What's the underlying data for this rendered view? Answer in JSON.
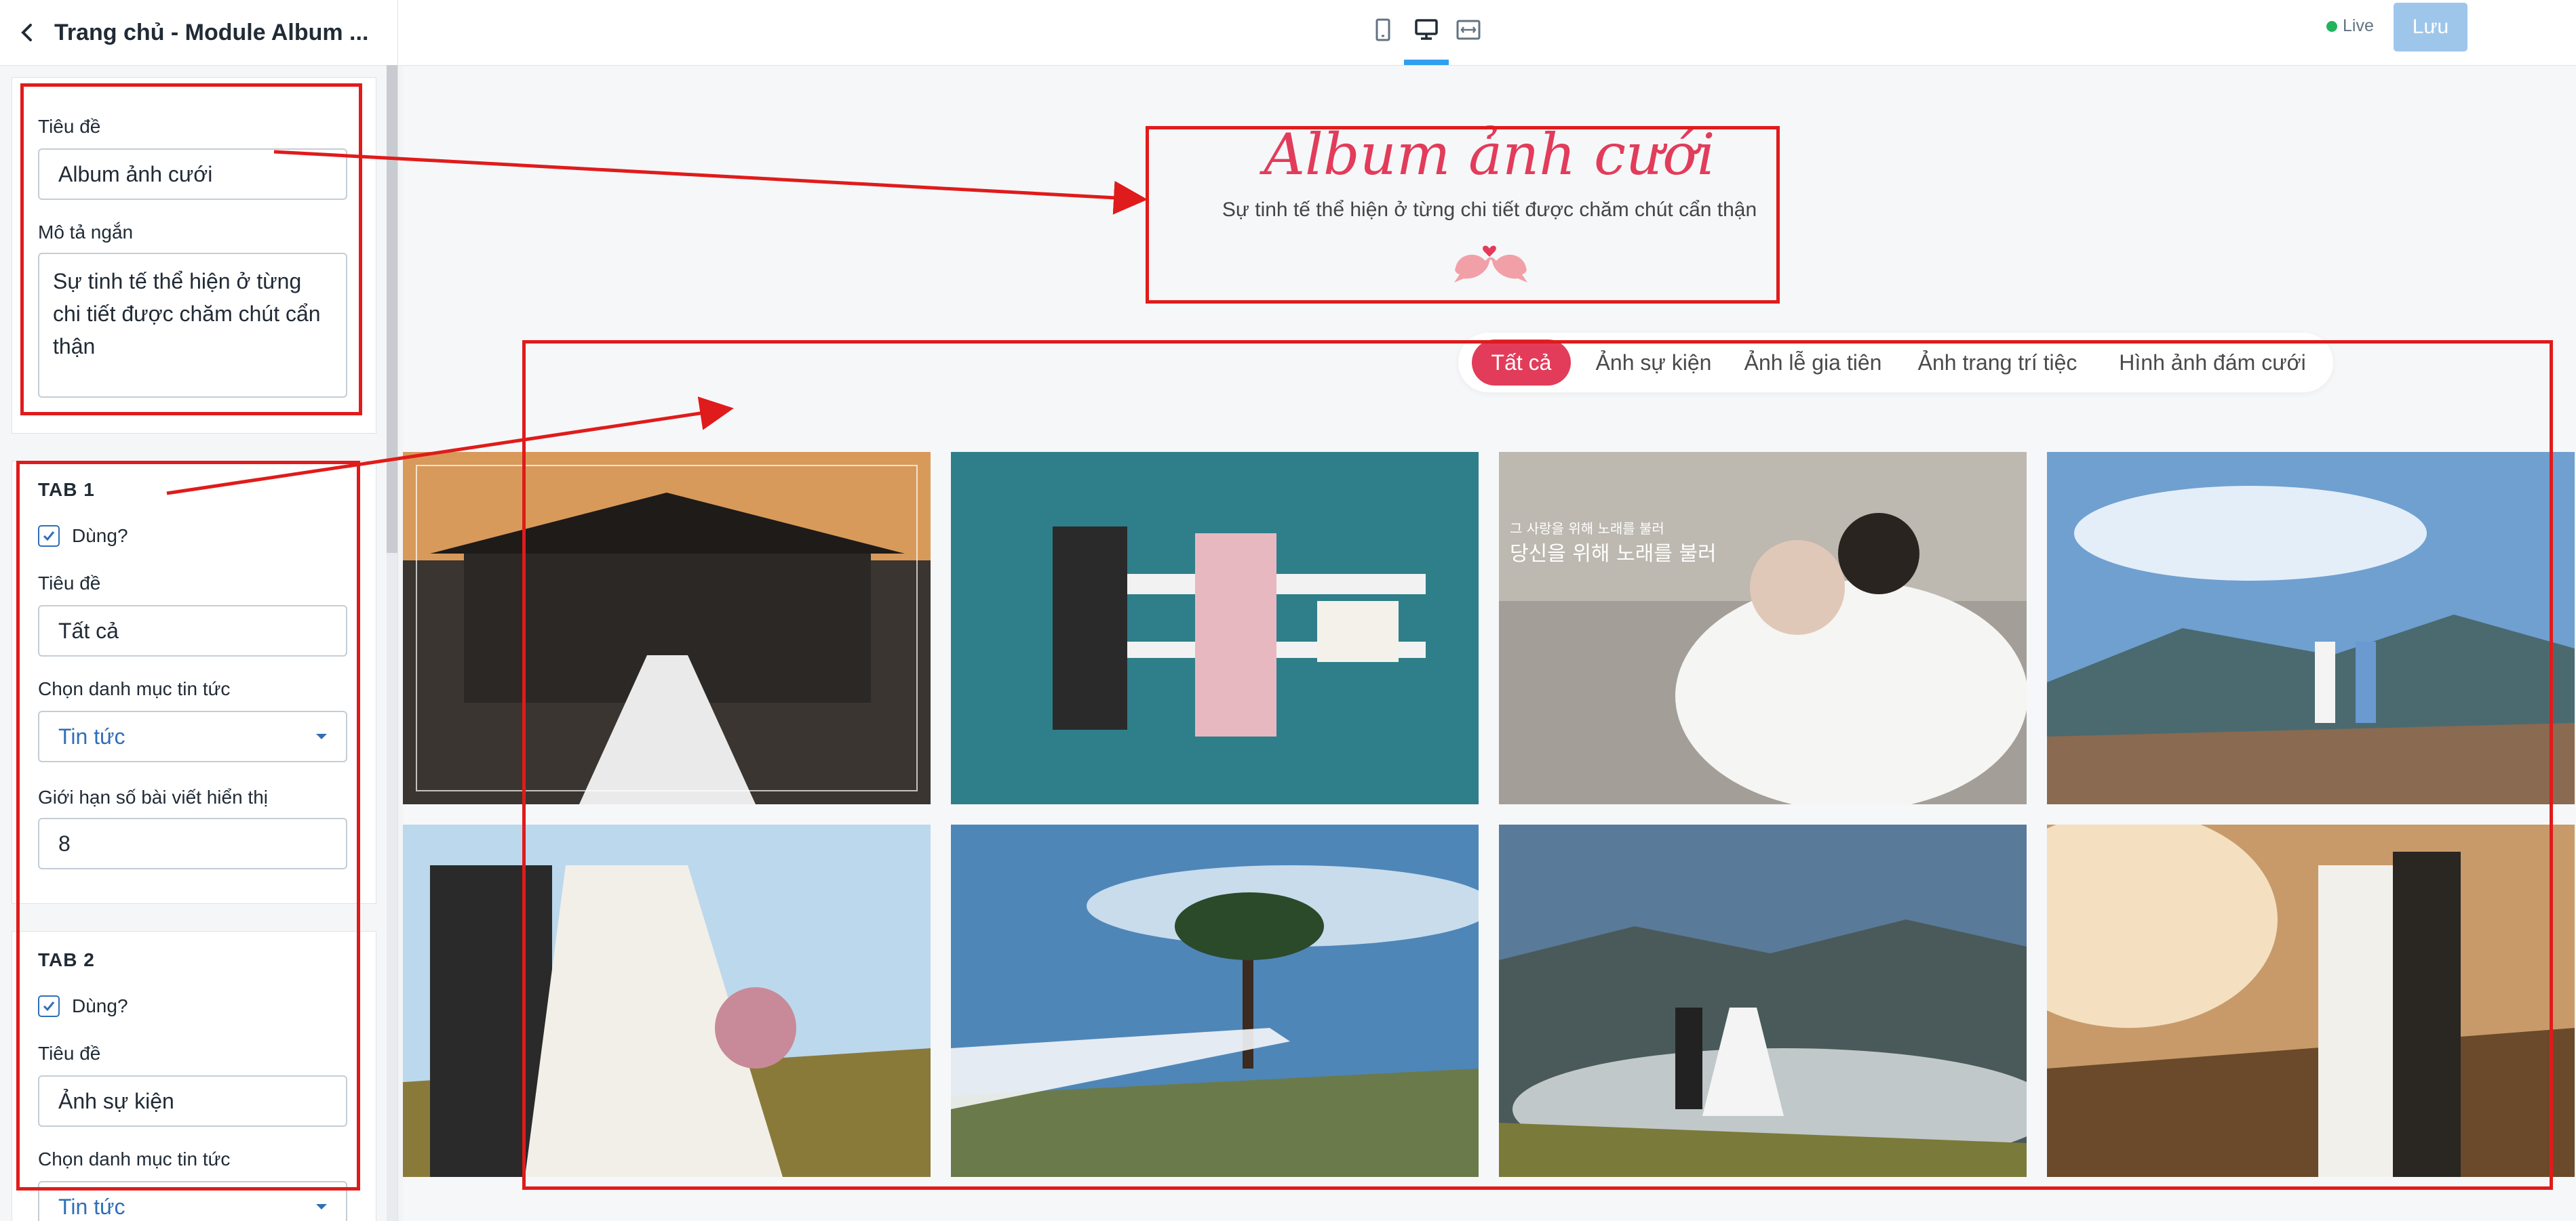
{
  "sidebar": {
    "title": "Trang chủ - Module Album ...",
    "section_main": {
      "title_label": "Tiêu đề",
      "title_value": "Album ảnh cưới",
      "desc_label": "Mô tả ngắn",
      "desc_value": "Sự tinh tế thể hiện ở từng chi tiết được chăm chút cẩn thận"
    },
    "tab1": {
      "heading": "TAB 1",
      "enabled_label": "Dùng?",
      "title_label": "Tiêu đề",
      "title_value": "Tất cả",
      "category_label": "Chọn danh mục tin tức",
      "category_value": "Tin tức",
      "limit_label": "Giới hạn số bài viết hiển thị",
      "limit_value": "8"
    },
    "tab2": {
      "heading": "TAB 2",
      "enabled_label": "Dùng?",
      "title_label": "Tiêu đề",
      "title_value": "Ảnh sự kiện",
      "category_label": "Chọn danh mục tin tức",
      "category_value": "Tin tức"
    }
  },
  "topbar": {
    "devices": [
      "mobile-icon",
      "desktop-icon",
      "fullwidth-icon"
    ],
    "active_device": "desktop",
    "live_label": "Live",
    "save_label": "Lưu"
  },
  "preview": {
    "album_title": "Album ảnh cưới",
    "album_desc": "Sự tinh tế thể hiện ở từng chi tiết được chăm chút cẩn thận",
    "tabs": [
      "Tất cả",
      "Ảnh sự kiện",
      "Ảnh lễ gia tiên",
      "Ảnh trang trí tiệc",
      "Hình ảnh đám cưới"
    ],
    "active_tab": 0,
    "photo_overlay_text": [
      "그 사랑을 위해 노래를 불러",
      "당신을 위해 노래를 불러"
    ]
  },
  "colors": {
    "accent": "#e23c5a",
    "annotation": "#e01b1b",
    "save_button": "#9ec6ea",
    "link": "#2f6fb7",
    "live_dot": "#22b35e"
  }
}
